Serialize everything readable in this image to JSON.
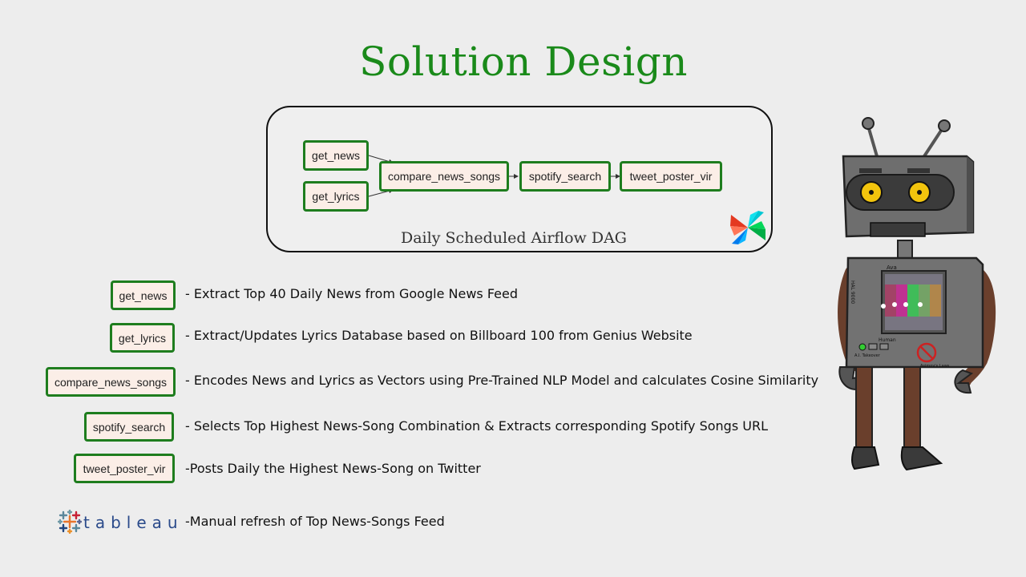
{
  "slide": {
    "title": "Solution Design"
  },
  "dag": {
    "caption": "Daily Scheduled Airflow DAG",
    "nodes": [
      "get_news",
      "get_lyrics",
      "compare_news_songs",
      "spotify_search",
      "tweet_poster_vir"
    ]
  },
  "tasks": [
    {
      "name": "get_news",
      "description": "- Extract Top 40 Daily News from Google News Feed"
    },
    {
      "name": "get_lyrics",
      "description": "- Extract/Updates Lyrics Database based on Billboard 100 from Genius Website"
    },
    {
      "name": "compare_news_songs",
      "description": "- Encodes News and Lyrics as Vectors using Pre-Trained NLP Model and calculates Cosine Similarity"
    },
    {
      "name": "spotify_search",
      "description": "- Selects Top Highest News-Song Combination & Extracts corresponding Spotify Songs URL"
    },
    {
      "name": "tweet_poster_vir",
      "description": "-Posts Daily the Highest News-Song on Twitter"
    }
  ],
  "tableau": {
    "logo_text": "tableau",
    "description": "-Manual refresh of Top News-Songs Feed"
  },
  "robot": {
    "labels": {
      "head_plate": "Ava",
      "side_text": "HAL 9000",
      "button_caption": "A.I. Takeover",
      "human_label": "Human",
      "laws_label": "Asimov's Laws"
    }
  },
  "colors": {
    "title": "#1a8a1a",
    "node_border": "#1e7d1e",
    "node_fill": "#fbeee7",
    "background": "#ededed"
  },
  "icons": [
    "airflow-pinwheel-icon",
    "tableau-logo-icon",
    "robot-illustration"
  ]
}
